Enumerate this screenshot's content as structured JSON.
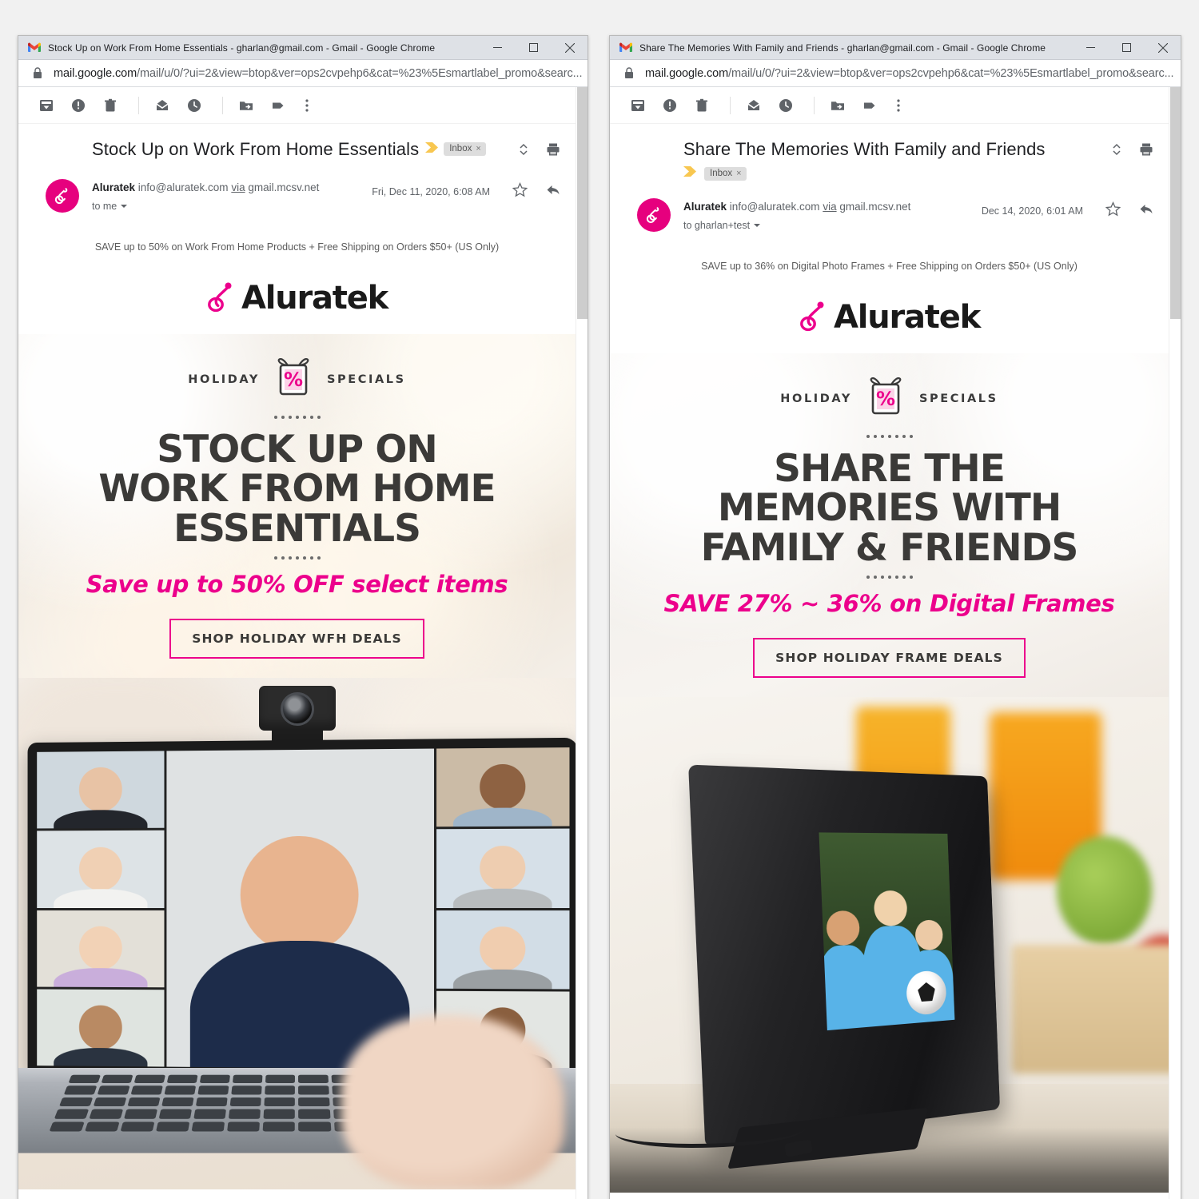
{
  "windows": [
    {
      "id": "left",
      "titlebar": {
        "favicon": "gmail-icon",
        "title": "Stock Up on Work From Home Essentials - gharlan@gmail.com - Gmail - Google Chrome",
        "minimize": "–",
        "maximize": "□",
        "close": "✕"
      },
      "omnibox": {
        "lock_icon": "lock-icon",
        "url_prefix": "mail.google.com",
        "url_rest": "/mail/u/0/?ui=2&view=btop&ver=ops2cvpehp6&cat=%23%5Esmartlabel_promo&searc..."
      },
      "toolbar": {
        "items": [
          {
            "name": "archive-icon",
            "title": "Archive"
          },
          {
            "name": "report-spam-icon",
            "title": "Report spam"
          },
          {
            "name": "delete-icon",
            "title": "Delete"
          },
          {
            "name": "mark-unread-icon",
            "title": "Mark as unread"
          },
          {
            "name": "snooze-icon",
            "title": "Snooze"
          },
          {
            "name": "move-to-icon",
            "title": "Move to"
          },
          {
            "name": "labels-icon",
            "title": "Labels"
          },
          {
            "name": "more-icon",
            "title": "More"
          }
        ]
      },
      "thread": {
        "subject": "Stock Up on Work From Home Essentials",
        "label_chip": "Inbox",
        "label_chip_remove": "×",
        "expand_icon": "expand-collapse-icon",
        "print_icon": "print-icon",
        "labels_inline": true,
        "sender_name": "Aluratek",
        "sender_email": "info@aluratek.com",
        "via_word": "via",
        "via_domain": "gmail.mcsv.net",
        "recipient": "to me",
        "date": "Fri, Dec 11, 2020, 6:08 AM",
        "star_icon": "star-icon",
        "reply_icon": "reply-icon"
      },
      "email": {
        "preheader": "SAVE up to 50% on Work From Home Products + Free Shipping on Orders $50+ (US Only)",
        "brand": "Aluratek",
        "brand_mark": "aluratek-logo-icon",
        "badge_left": "HOLIDAY",
        "badge_icon": "gift-percent-icon",
        "badge_right": "SPECIALS",
        "headline_lines": [
          "STOCK UP ON",
          "WORK FROM HOME",
          "ESSENTIALS"
        ],
        "subhead": "Save up to 50% OFF select items",
        "cta": "SHOP HOLIDAY WFH DEALS",
        "hero_image_alt": "laptop-video-call-webcam-photo"
      }
    },
    {
      "id": "right",
      "titlebar": {
        "favicon": "gmail-icon",
        "title": "Share The Memories With Family and Friends - gharlan@gmail.com - Gmail - Google Chrome",
        "minimize": "–",
        "maximize": "□",
        "close": "✕"
      },
      "omnibox": {
        "lock_icon": "lock-icon",
        "url_prefix": "mail.google.com",
        "url_rest": "/mail/u/0/?ui=2&view=btop&ver=ops2cvpehp6&cat=%23%5Esmartlabel_promo&searc..."
      },
      "toolbar": {
        "items": [
          {
            "name": "archive-icon",
            "title": "Archive"
          },
          {
            "name": "report-spam-icon",
            "title": "Report spam"
          },
          {
            "name": "delete-icon",
            "title": "Delete"
          },
          {
            "name": "mark-unread-icon",
            "title": "Mark as unread"
          },
          {
            "name": "snooze-icon",
            "title": "Snooze"
          },
          {
            "name": "move-to-icon",
            "title": "Move to"
          },
          {
            "name": "labels-icon",
            "title": "Labels"
          },
          {
            "name": "more-icon",
            "title": "More"
          }
        ]
      },
      "thread": {
        "subject": "Share The Memories With Family and Friends",
        "label_chip": "Inbox",
        "label_chip_remove": "×",
        "expand_icon": "expand-collapse-icon",
        "print_icon": "print-icon",
        "labels_inline": false,
        "sender_name": "Aluratek",
        "sender_email": "info@aluratek.com",
        "via_word": "via",
        "via_domain": "gmail.mcsv.net",
        "recipient": "to gharlan+test",
        "date": "Dec 14, 2020, 6:01 AM",
        "star_icon": "star-icon",
        "reply_icon": "reply-icon"
      },
      "email": {
        "preheader": "SAVE up to 36% on Digital Photo Frames + Free Shipping on Orders $50+ (US Only)",
        "brand": "Aluratek",
        "brand_mark": "aluratek-logo-icon",
        "badge_left": "HOLIDAY",
        "badge_icon": "gift-percent-icon",
        "badge_right": "SPECIALS",
        "headline_lines": [
          "SHARE THE",
          "MEMORIES WITH",
          "FAMILY & FRIENDS"
        ],
        "subhead": "SAVE 27% ~ 36% on Digital Frames",
        "cta": "SHOP HOLIDAY FRAME DEALS",
        "hero_image_alt": "digital-photo-frame-kids-soccer-photo"
      }
    }
  ],
  "colors": {
    "brand_magenta": "#ec008c",
    "avatar_magenta": "#e6007e",
    "headline_dark": "#3b3a38",
    "chrome_titlebar": "#dee1e6",
    "desktop_bg": "#f1f1f1",
    "label_chip_bg": "#dddddd",
    "label_arrow_yellow": "#f8c750"
  }
}
